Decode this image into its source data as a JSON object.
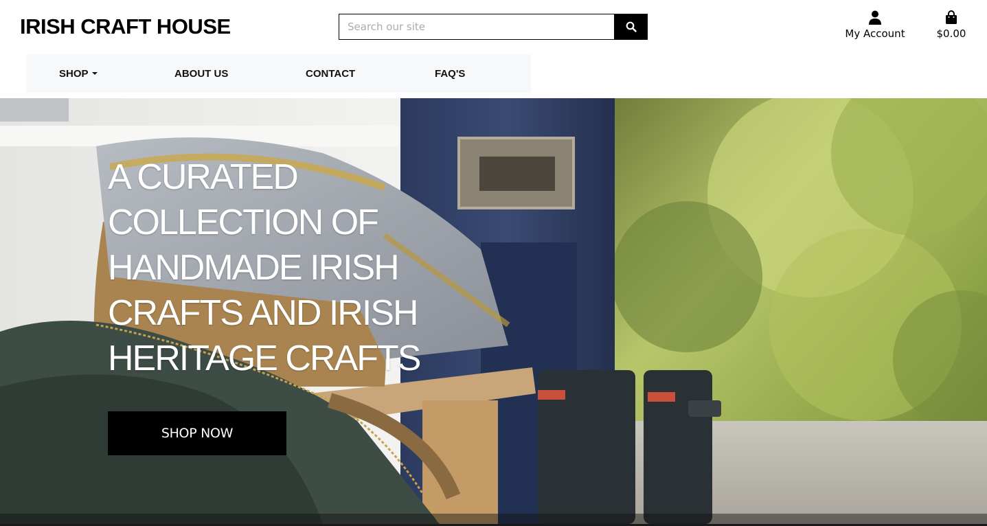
{
  "header": {
    "brand": "IRISH CRAFT HOUSE",
    "search": {
      "placeholder": "Search our site",
      "value": ""
    },
    "account_label": "My Account",
    "bag_total": "$0.00"
  },
  "nav": {
    "items": [
      {
        "label": "SHOP",
        "has_dropdown": true
      },
      {
        "label": "ABOUT US"
      },
      {
        "label": "CONTACT"
      },
      {
        "label": "FAQ'S"
      }
    ]
  },
  "hero": {
    "heading": "A CURATED COLLECTION OF HANDMADE IRISH CRAFTS AND IRISH HERITAGE CRAFTS",
    "cta": "SHOP NOW"
  },
  "icons": {
    "search": "search-icon",
    "account": "user-icon",
    "bag": "shopping-bag-icon",
    "dropdown": "caret-down-icon"
  },
  "colors": {
    "accent": "#000000",
    "nav_background": "#f7f8fa",
    "hero_text": "#ffffff"
  }
}
